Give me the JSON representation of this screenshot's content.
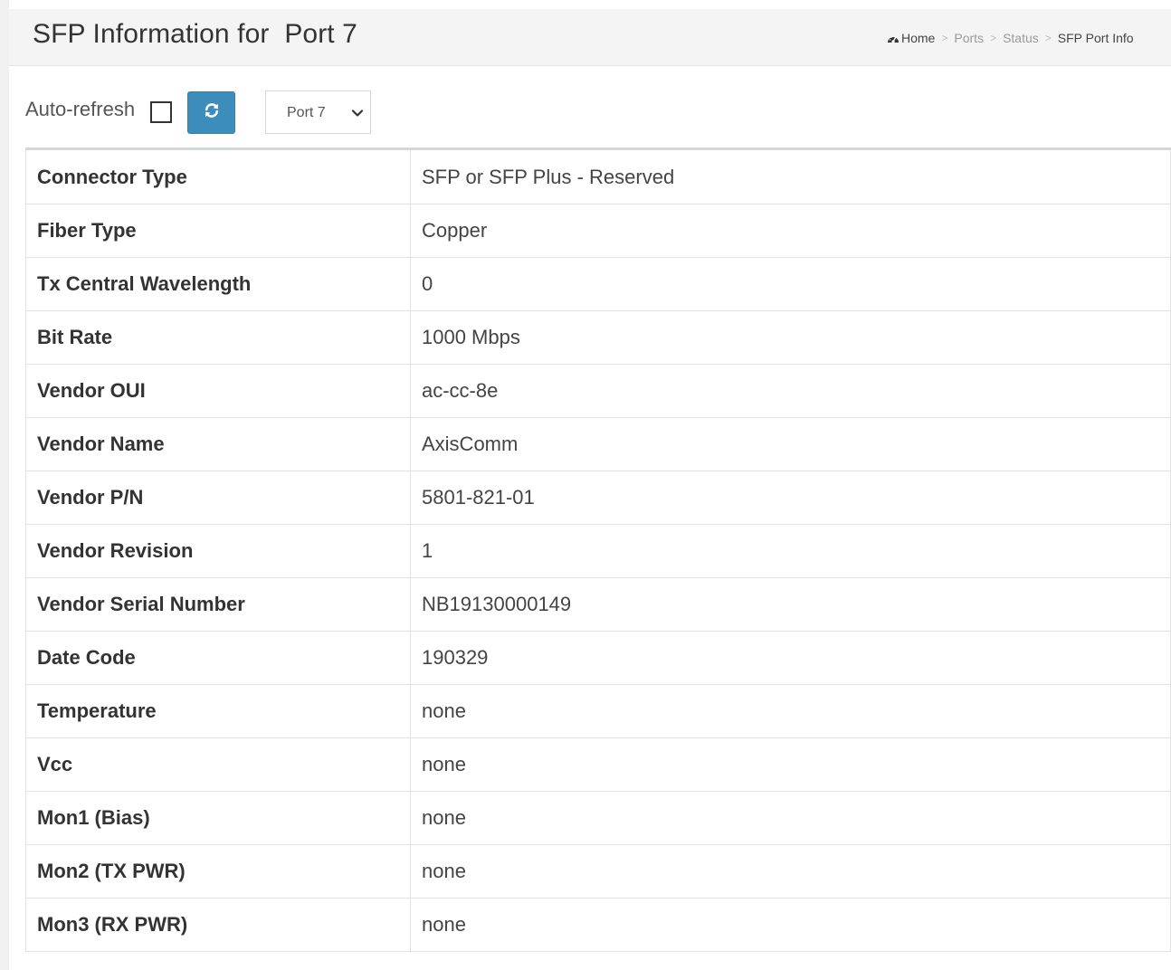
{
  "header": {
    "title": "SFP Information for  Port 7"
  },
  "breadcrumb": {
    "items": [
      "Home",
      "Ports",
      "Status",
      "SFP Port Info"
    ],
    "separator": ">"
  },
  "toolbar": {
    "auto_refresh_label": "Auto-refresh",
    "auto_refresh_checked": false,
    "refresh_icon": "refresh-icon",
    "port_select_value": "Port 7"
  },
  "colors": {
    "accent": "#3c8dbc",
    "header_bg": "#f4f4f4"
  },
  "sfp_info": [
    {
      "label": "Connector Type",
      "value": "SFP or SFP Plus - Reserved"
    },
    {
      "label": "Fiber Type",
      "value": "Copper"
    },
    {
      "label": "Tx Central Wavelength",
      "value": "0"
    },
    {
      "label": "Bit Rate",
      "value": "1000 Mbps"
    },
    {
      "label": "Vendor OUI",
      "value": "ac-cc-8e"
    },
    {
      "label": "Vendor Name",
      "value": "AxisComm"
    },
    {
      "label": "Vendor P/N",
      "value": "5801-821-01"
    },
    {
      "label": "Vendor Revision",
      "value": "1"
    },
    {
      "label": "Vendor Serial Number",
      "value": "NB19130000149"
    },
    {
      "label": "Date Code",
      "value": "190329"
    },
    {
      "label": "Temperature",
      "value": "none"
    },
    {
      "label": "Vcc",
      "value": "none"
    },
    {
      "label": "Mon1 (Bias)",
      "value": "none"
    },
    {
      "label": "Mon2 (TX PWR)",
      "value": "none"
    },
    {
      "label": "Mon3 (RX PWR)",
      "value": "none"
    }
  ]
}
